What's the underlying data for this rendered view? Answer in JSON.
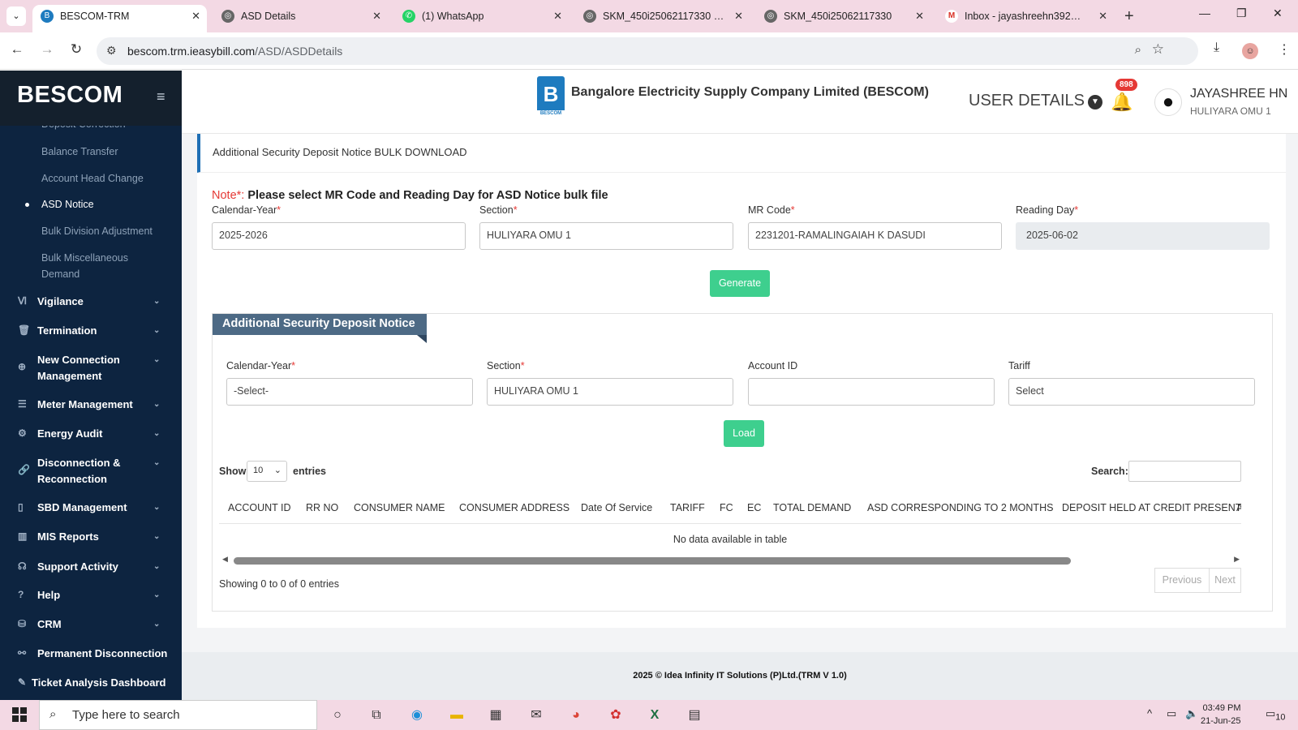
{
  "browser": {
    "tabs": [
      {
        "title": "BESCOM-TRM",
        "active": true,
        "icon": "bescom-favicon"
      },
      {
        "title": "ASD Details",
        "active": false,
        "icon": "globe-icon"
      },
      {
        "title": "(1) WhatsApp",
        "active": false,
        "icon": "whatsapp-icon"
      },
      {
        "title": "SKM_450i25062117330 - 202",
        "active": false,
        "icon": "globe-icon"
      },
      {
        "title": "SKM_450i25062117330",
        "active": false,
        "icon": "globe-icon"
      },
      {
        "title": "Inbox - jayashreehn392@gm",
        "active": false,
        "icon": "gmail-icon"
      }
    ],
    "url_host": "bescom.trm.ieasybill.com",
    "url_path": "/ASD/ASDDetails"
  },
  "sidebar": {
    "brand": "BESCOM",
    "subitems": [
      {
        "label": "Deposit Correction",
        "active": false
      },
      {
        "label": "Balance Transfer",
        "active": false
      },
      {
        "label": "Account Head Change",
        "active": false
      },
      {
        "label": "ASD Notice",
        "active": true
      },
      {
        "label": "Bulk Division Adjustment",
        "active": false
      },
      {
        "label": "Bulk Miscellaneous",
        "active": false
      },
      {
        "label": "Demand",
        "active": false
      }
    ],
    "menu": [
      {
        "label": "Vigilance",
        "icon": "vk-icon"
      },
      {
        "label": "Termination",
        "icon": "trash-icon"
      },
      {
        "label": "New Connection",
        "label2": "Management",
        "icon": "plus-circle-icon"
      },
      {
        "label": "Meter Management",
        "icon": "list-icon"
      },
      {
        "label": "Energy Audit",
        "icon": "users-gear-icon"
      },
      {
        "label": "Disconnection &",
        "label2": "Reconnection",
        "icon": "link-icon"
      },
      {
        "label": "SBD Management",
        "icon": "mobile-icon"
      },
      {
        "label": "MIS Reports",
        "icon": "bar-chart-icon"
      },
      {
        "label": "Support Activity",
        "icon": "headset-icon"
      },
      {
        "label": "Help",
        "icon": "question-icon"
      },
      {
        "label": "CRM",
        "icon": "database-icon"
      },
      {
        "label": "Permanent Disconnection",
        "icon": "unlink-icon"
      },
      {
        "label": "Ticket Analysis Dashboard",
        "icon": "pencil-icon"
      }
    ]
  },
  "header": {
    "company": "Bangalore Electricity Supply Company Limited (BESCOM)",
    "user_details": "USER DETAILS",
    "notification_count": "898",
    "user_name": "JAYASHREE HN",
    "user_section": "HULIYARA OMU 1"
  },
  "bulk": {
    "title": "Additional Security Deposit Notice BULK DOWNLOAD",
    "note_label": "Note*:",
    "note_text": " Please select MR Code and Reading Day for ASD Notice bulk file",
    "fields": {
      "calendar_year": {
        "label": "Calendar-Year",
        "value": "2025-2026"
      },
      "section": {
        "label": "Section",
        "value": "HULIYARA OMU 1"
      },
      "mr_code": {
        "label": "MR Code",
        "value": "2231201-RAMALINGAIAH K DASUDI"
      },
      "reading_day": {
        "label": "Reading Day",
        "value": "2025-06-02"
      }
    },
    "generate_label": "Generate"
  },
  "asd": {
    "title": "Additional Security Deposit Notice",
    "fields": {
      "calendar_year": {
        "label": "Calendar-Year",
        "value": "-Select-"
      },
      "section": {
        "label": "Section",
        "value": "HULIYARA OMU 1"
      },
      "account_id": {
        "label": "Account ID",
        "value": ""
      },
      "tariff": {
        "label": "Tariff",
        "value": "Select"
      }
    },
    "load_label": "Load",
    "show_label": "Show",
    "entries_value": "10",
    "entries_label": "entries",
    "search_label": "Search:",
    "columns": [
      "ACCOUNT ID",
      "RR NO",
      "CONSUMER NAME",
      "CONSUMER ADDRESS",
      "Date Of Service",
      "TARIFF",
      "FC",
      "EC",
      "TOTAL DEMAND",
      "ASD CORRESPONDING TO 2 MONTHS",
      "DEPOSIT HELD AT CREDIT PRESENTLY",
      "A"
    ],
    "empty_text": "No data available in table",
    "showing_text": "Showing 0 to 0 of 0 entries",
    "previous_label": "Previous",
    "next_label": "Next"
  },
  "footer": {
    "text": "2025 © Idea Infinity IT Solutions (P)Ltd.(TRM V 1.0)"
  },
  "taskbar": {
    "search_placeholder": "Type here to search",
    "time": "03:49 PM",
    "date": "21-Jun-25",
    "notifications": "10"
  }
}
